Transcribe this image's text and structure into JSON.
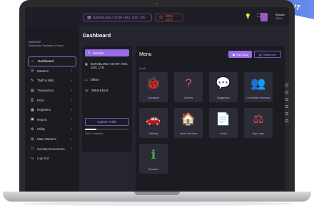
{
  "banner": {
    "text": "CIENT"
  },
  "topbar": {
    "society_chip": "BARCELONA CO-OP. HOU. SOC. LTD",
    "phone_chip": "9004-2077",
    "user_name": "Rishabh",
    "user_role": "Officer"
  },
  "sidebar": {
    "section_title": "General",
    "section_subtitle": "Dashboards, Transaction & Report...",
    "items": [
      {
        "label": "Dashboard",
        "icon": "home-icon",
        "glyph": "⌂",
        "active": true,
        "chevron": false
      },
      {
        "label": "Masters",
        "icon": "list-icon",
        "glyph": "☰",
        "active": false,
        "chevron": true
      },
      {
        "label": "Tariff & Bills",
        "icon": "tag-icon",
        "glyph": "✎",
        "active": false,
        "chevron": true
      },
      {
        "label": "Transaction",
        "icon": "card-icon",
        "glyph": "▤",
        "active": false,
        "chevron": true
      },
      {
        "label": "Print",
        "icon": "printer-icon",
        "glyph": "⎙",
        "active": false,
        "chevron": true
      },
      {
        "label": "Registers",
        "icon": "register-icon",
        "glyph": "▦",
        "active": false,
        "chevron": true
      },
      {
        "label": "Report",
        "icon": "report-icon",
        "glyph": "▣",
        "active": false,
        "chevron": true
      },
      {
        "label": "Utility",
        "icon": "utility-icon",
        "glyph": "⚙",
        "active": false,
        "chevron": true
      },
      {
        "label": "Main Masters",
        "icon": "grid-icon",
        "glyph": "⊞",
        "active": false,
        "chevron": true
      },
      {
        "label": "Society Documents",
        "icon": "document-icon",
        "glyph": "▭",
        "active": false,
        "chevron": true
      },
      {
        "label": "Log Out",
        "icon": "logout-icon",
        "glyph": "↪",
        "active": false,
        "chevron": false
      }
    ]
  },
  "main": {
    "title": "Dashboard",
    "profile": {
      "name": "Rishabh",
      "society": "BARCELONA CO-OP. HOS. SOC. LTD",
      "role": "Officer",
      "phone": "9004161644",
      "update_button": "Update Profile",
      "completion": 0.25,
      "completion_label": "25% Completed"
    },
    "menu": {
      "title": "Menu",
      "pay_now": "Pay Now",
      "statement": "Statement",
      "quick_label": "Quick",
      "tiles": [
        {
          "label": "Complaint",
          "icon": "bug-icon",
          "glyph": "🐞",
          "color": "#8a4fe0"
        },
        {
          "label": "Queries",
          "icon": "question-icon",
          "glyph": "?",
          "color": "#e24a5a"
        },
        {
          "label": "Suggestion",
          "icon": "chat-icon",
          "glyph": "💬",
          "color": "#4caf50"
        },
        {
          "label": "Committee Members",
          "icon": "people-icon",
          "glyph": "👥",
          "color": "#9c5ae0"
        },
        {
          "label": "Parking",
          "icon": "car-icon",
          "glyph": "🚗",
          "color": "#b050e0"
        },
        {
          "label": "Home Services",
          "icon": "home-services-icon",
          "glyph": "🏠",
          "color": "#e24a5a"
        },
        {
          "label": "Forms",
          "icon": "forms-icon",
          "glyph": "📄",
          "color": "#8a4fe0"
        },
        {
          "label": "Bye Laws",
          "icon": "gavel-icon",
          "glyph": "⚖",
          "color": "#e24a5a"
        },
        {
          "label": "Circulars",
          "icon": "info-icon",
          "glyph": "ℹ",
          "color": "#4caf50"
        }
      ]
    }
  }
}
